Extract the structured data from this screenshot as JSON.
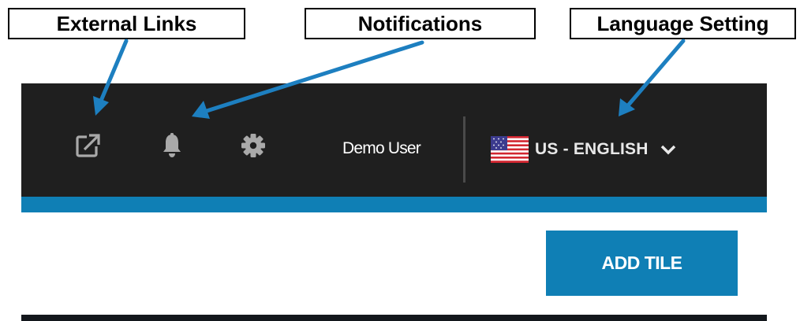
{
  "annotations": {
    "external_links": "External Links",
    "notifications": "Notifications",
    "language_setting": "Language Setting"
  },
  "header": {
    "icons": {
      "external_link": "external-link-icon",
      "notifications": "bell-icon",
      "settings": "gear-icon"
    },
    "user_name": "Demo User",
    "language": {
      "flag": "us-flag-icon",
      "label": "US - ENGLISH",
      "dropdown_icon": "chevron-down-icon"
    }
  },
  "toolbar": {
    "add_tile_label": "ADD TILE"
  },
  "colors": {
    "header_bg": "#1f1f1f",
    "accent": "#0f7fb5",
    "icon": "#a9a9a9",
    "annotation_arrow": "#1d7fc0"
  }
}
